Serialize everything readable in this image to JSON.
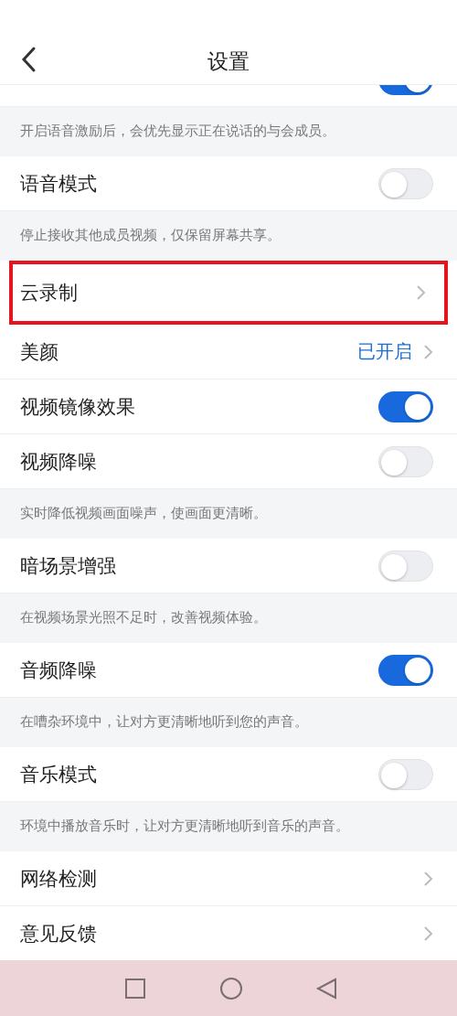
{
  "header": {
    "title": "设置"
  },
  "items": [
    {
      "kind": "toggle",
      "on": true
    },
    {
      "kind": "hint",
      "text": "开启语音激励后，会优先显示正在说话的与会成员。"
    },
    {
      "kind": "toggle",
      "label": "语音模式",
      "on": false
    },
    {
      "kind": "hint",
      "text": "停止接收其他成员视频，仅保留屏幕共享。"
    },
    {
      "kind": "link",
      "label": "云录制",
      "highlighted": true
    },
    {
      "kind": "link",
      "label": "美颜",
      "value": "已开启",
      "highlighted": false
    },
    {
      "kind": "toggle",
      "label": "视频镜像效果",
      "on": true
    },
    {
      "kind": "toggle",
      "label": "视频降噪",
      "on": false
    },
    {
      "kind": "hint",
      "text": "实时降低视频画面噪声，使画面更清晰。"
    },
    {
      "kind": "toggle",
      "label": "暗场景增强",
      "on": false
    },
    {
      "kind": "hint",
      "text": "在视频场景光照不足时，改善视频体验。"
    },
    {
      "kind": "toggle",
      "label": "音频降噪",
      "on": true
    },
    {
      "kind": "hint",
      "text": "在嘈杂环境中，让对方更清晰地听到您的声音。"
    },
    {
      "kind": "toggle",
      "label": "音乐模式",
      "on": false
    },
    {
      "kind": "hint",
      "text": "环境中播放音乐时，让对方更清晰地听到音乐的声音。"
    },
    {
      "kind": "link",
      "label": "网络检测",
      "highlighted": false
    },
    {
      "kind": "link",
      "label": "意见反馈",
      "highlighted": false
    }
  ]
}
